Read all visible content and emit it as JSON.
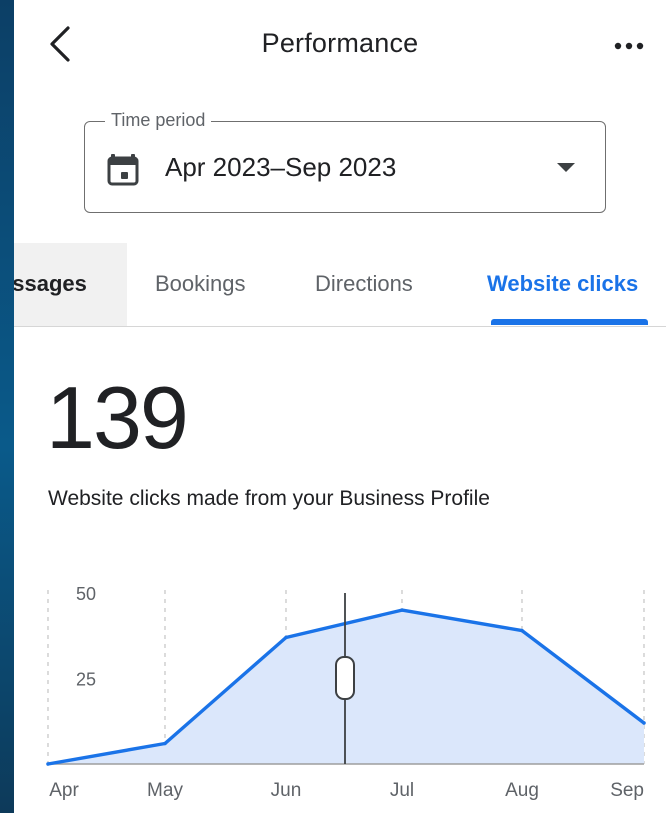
{
  "header": {
    "title": "Performance",
    "back_icon": "chevron-left-icon",
    "more_icon": "more-horizontal-icon"
  },
  "time_period": {
    "label": "Time period",
    "value": "Apr 2023–Sep 2023",
    "icon": "calendar-icon"
  },
  "tabs": [
    {
      "label": "essages",
      "active": false
    },
    {
      "label": "Bookings",
      "active": false
    },
    {
      "label": "Directions",
      "active": false
    },
    {
      "label": "Website clicks",
      "active": true
    }
  ],
  "metric": {
    "value": "139",
    "description": "Website clicks made from your Business Profile"
  },
  "colors": {
    "accent": "#1a73e8",
    "area_fill": "#dbe7fb",
    "text_primary": "#202124",
    "text_secondary": "#5f6368"
  },
  "chart_data": {
    "type": "area",
    "categories": [
      "Apr",
      "May",
      "Jun",
      "Jul",
      "Aug",
      "Sep"
    ],
    "values": [
      0,
      6,
      37,
      45,
      39,
      12
    ],
    "y_ticks": [
      "50",
      "25"
    ],
    "ylim": [
      0,
      50
    ],
    "grid": true,
    "title": "",
    "xlabel": "",
    "ylabel": "",
    "cursor_value": 41
  }
}
